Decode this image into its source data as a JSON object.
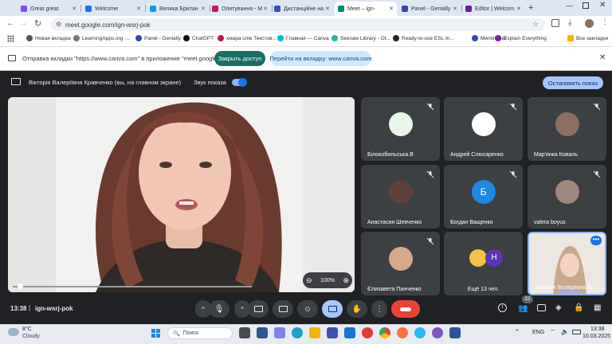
{
  "browser": {
    "tabs": [
      {
        "title": "Great great",
        "color": "#7c4dff"
      },
      {
        "title": "Welcome",
        "color": "#1a73e8"
      },
      {
        "title": "Велика Британ",
        "color": "#00a3e0"
      },
      {
        "title": "Опитування - M",
        "color": "#c2185b"
      },
      {
        "title": "Дистанційне на",
        "color": "#3f51b5"
      },
      {
        "title": "Meet – ign-",
        "color": "#00897b"
      },
      {
        "title": "Panel - Genially",
        "color": "#3949ab"
      },
      {
        "title": "Editor | Welcom",
        "color": "#6a1b9a"
      }
    ],
    "url": "meet.google.com/ign-wsrj-pok",
    "bookmarks": [
      {
        "label": "Новая вкладка",
        "color": "#555"
      },
      {
        "label": "LearningApps.org -...",
        "color": "#777"
      },
      {
        "label": "Panel - Genially",
        "color": "#3949ab"
      },
      {
        "label": "ChatGPT",
        "color": "#111"
      },
      {
        "label": "хмара слів Текстов...",
        "color": "#c2185b"
      },
      {
        "label": "Главная — Canva",
        "color": "#00bcd4"
      },
      {
        "label": "Seesaw Library - Ot...",
        "color": "#2bb3a3"
      },
      {
        "label": "Ready-to-use ESL m...",
        "color": "#222"
      },
      {
        "label": "Mentimeter",
        "color": "#3949ab"
      },
      {
        "label": "Explain Everything",
        "color": "#7b1fa2"
      }
    ],
    "all_bookmarks": "Все закладки"
  },
  "infobar": {
    "message": "Отправка вкладки \"https://www.canva.com\" в приложение \"meet.google.com\".",
    "stop_label": "Закрыть доступ",
    "switch_label": "Перейти на вкладку: www.canva.com"
  },
  "presenting": {
    "text": "Вікторія Валеріївна Кравченко (вы, на главном экране)",
    "sound_label": "Звук показа",
    "stop_button": "Остановить показ"
  },
  "main_video": {
    "zoom": "100%"
  },
  "participants": [
    {
      "name": "Білокобильська.В",
      "avatar_color": "#e8f5e9"
    },
    {
      "name": "Андрей Слюсаренко",
      "avatar_color": "#ffffff"
    },
    {
      "name": "Мар'янка Коваль",
      "avatar_color": "#8d6e63"
    },
    {
      "name": "Анастасия Шевченко",
      "avatar_color": "#5d4037"
    },
    {
      "name": "Богдан Ващенко",
      "avatar_letter": "Б",
      "avatar_color": "#1e88e5"
    },
    {
      "name": "valera boyus",
      "avatar_color": "#a1887f"
    },
    {
      "name": "Єлизавета Панченко",
      "avatar_color": "#d7a88a"
    },
    {
      "name": "Ещё 13 чел.",
      "avatar_letter": "Н",
      "avatar_color": "#5e35b1"
    },
    {
      "name": "Вікторія Валеріївна Кр...",
      "avatar_color": "#c9b8a6"
    }
  ],
  "bottom_bar": {
    "time": "13:38",
    "meeting_code": "ign-wsrj-pok",
    "participants_count": "22"
  },
  "taskbar": {
    "weather_temp": "8°C",
    "weather_desc": "Cloudy",
    "search_placeholder": "Поиск",
    "lang": "ENG",
    "clock_time": "13:38",
    "clock_date": "10.03.2025"
  }
}
